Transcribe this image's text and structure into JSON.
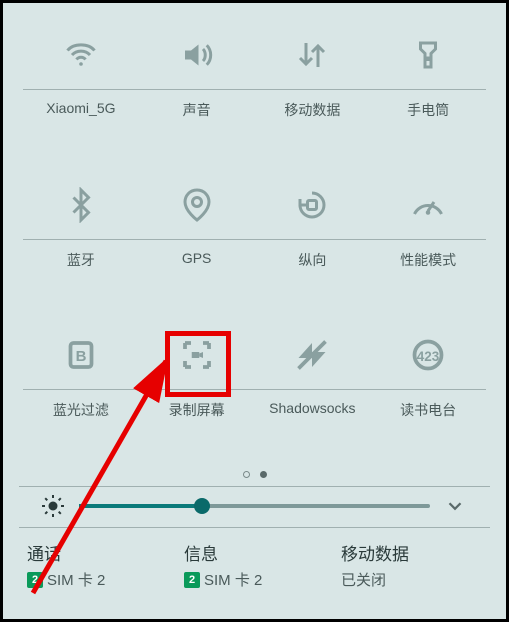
{
  "tiles": [
    {
      "icon": "wifi-icon",
      "label": "Xiaomi_5G"
    },
    {
      "icon": "volume-icon",
      "label": "声音"
    },
    {
      "icon": "data-arrows-icon",
      "label": "移动数据"
    },
    {
      "icon": "flashlight-icon",
      "label": "手电筒"
    },
    {
      "icon": "bluetooth-icon",
      "label": "蓝牙"
    },
    {
      "icon": "gps-icon",
      "label": "GPS"
    },
    {
      "icon": "rotation-icon",
      "label": "纵向"
    },
    {
      "icon": "performance-icon",
      "label": "性能模式"
    },
    {
      "icon": "bluelight-filter-icon",
      "label": "蓝光过滤"
    },
    {
      "icon": "screen-record-icon",
      "label": "录制屏幕"
    },
    {
      "icon": "shadowsocks-icon",
      "label": "Shadowsocks"
    },
    {
      "icon": "reading-radio-icon",
      "label": "读书电台"
    }
  ],
  "pager": {
    "total": 2,
    "current": 2
  },
  "slider": {
    "percent": 35
  },
  "bottom": {
    "call": {
      "title": "通话",
      "badge": "2",
      "sub": "SIM 卡 2"
    },
    "sms": {
      "title": "信息",
      "badge": "2",
      "sub": "SIM 卡 2"
    },
    "data": {
      "title": "移动数据",
      "sub": "已关闭"
    }
  }
}
